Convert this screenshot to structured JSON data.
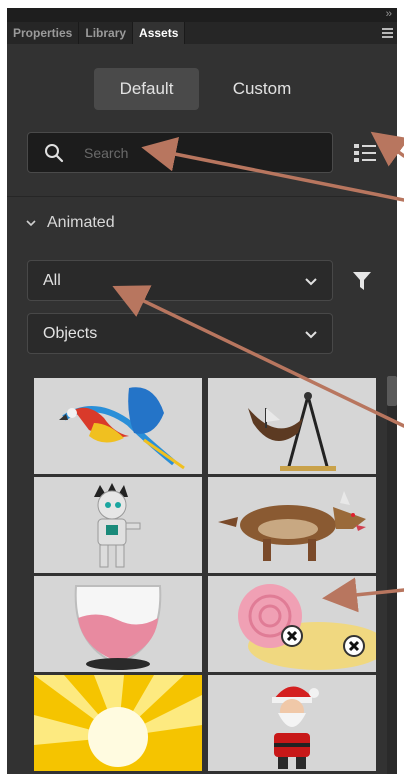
{
  "tabs": [
    {
      "label": "Properties",
      "active": false
    },
    {
      "label": "Library",
      "active": false
    },
    {
      "label": "Assets",
      "active": true
    }
  ],
  "collapse_icon": "double-chevron-right-icon",
  "panel_menu_icon": "hamburger-menu-icon",
  "segmented": {
    "default_label": "Default",
    "custom_label": "Custom",
    "selected": "Default"
  },
  "search": {
    "placeholder": "Search",
    "value": "",
    "icon": "search-icon"
  },
  "list_view_icon": "list-view-icon",
  "section": {
    "label": "Animated",
    "expanded": true
  },
  "filters": {
    "category": {
      "selected": "All"
    },
    "type": {
      "selected": "Objects"
    },
    "filter_icon": "funnel-icon"
  },
  "assets": [
    {
      "name": "parrot-asset"
    },
    {
      "name": "pirate-ship-swing-asset"
    },
    {
      "name": "mummy-character-asset"
    },
    {
      "name": "werewolf-asset"
    },
    {
      "name": "glass-bowl-liquid-asset"
    },
    {
      "name": "snail-sand-asset"
    },
    {
      "name": "sun-burst-asset"
    },
    {
      "name": "santa-claus-asset"
    }
  ],
  "colors": {
    "panel_bg": "#323232",
    "annotation_arrow": "#b8765f",
    "thumb_bg": "#d6d6d6"
  }
}
